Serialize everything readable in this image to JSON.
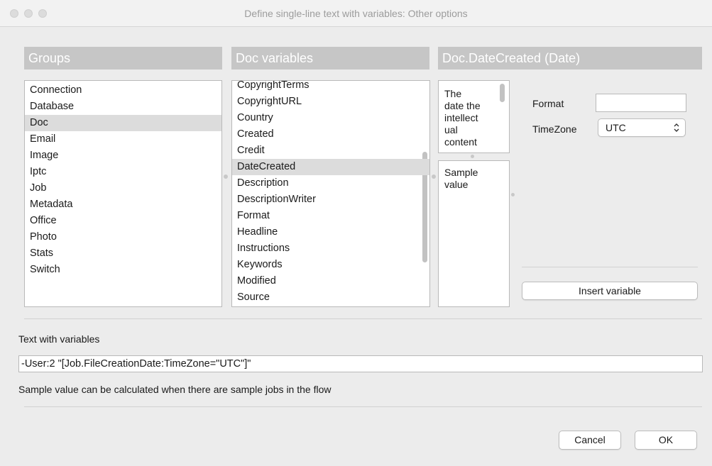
{
  "window": {
    "title": "Define single-line text with variables: Other options"
  },
  "groups": {
    "header": "Groups",
    "items": [
      "Connection",
      "Database",
      "Doc",
      "Email",
      "Image",
      "Iptc",
      "Job",
      "Metadata",
      "Office",
      "Photo",
      "Stats",
      "Switch"
    ],
    "selected": "Doc"
  },
  "variables": {
    "header": "Doc variables",
    "items": [
      "CopyrightTerms",
      "CopyrightURL",
      "Country",
      "Created",
      "Credit",
      "DateCreated",
      "Description",
      "DescriptionWriter",
      "Format",
      "Headline",
      "Instructions",
      "Keywords",
      "Modified",
      "Source"
    ],
    "selected": "DateCreated"
  },
  "detail": {
    "header": "Doc.DateCreated (Date)",
    "description": "The date the intellect ual content",
    "description_lines": "The\ndate the\nintellect\nual\ncontent",
    "sample": "Sample\nvalue",
    "format_label": "Format",
    "format_value": "",
    "timezone_label": "TimeZone",
    "timezone_value": "UTC",
    "insert_button": "Insert variable"
  },
  "text_with_variables": {
    "label": "Text with variables",
    "value": "-User:2 \"[Job.FileCreationDate:TimeZone=\"UTC\"]\"",
    "hint": "Sample value can be calculated when there are sample jobs in the flow"
  },
  "footer": {
    "cancel": "Cancel",
    "ok": "OK"
  }
}
